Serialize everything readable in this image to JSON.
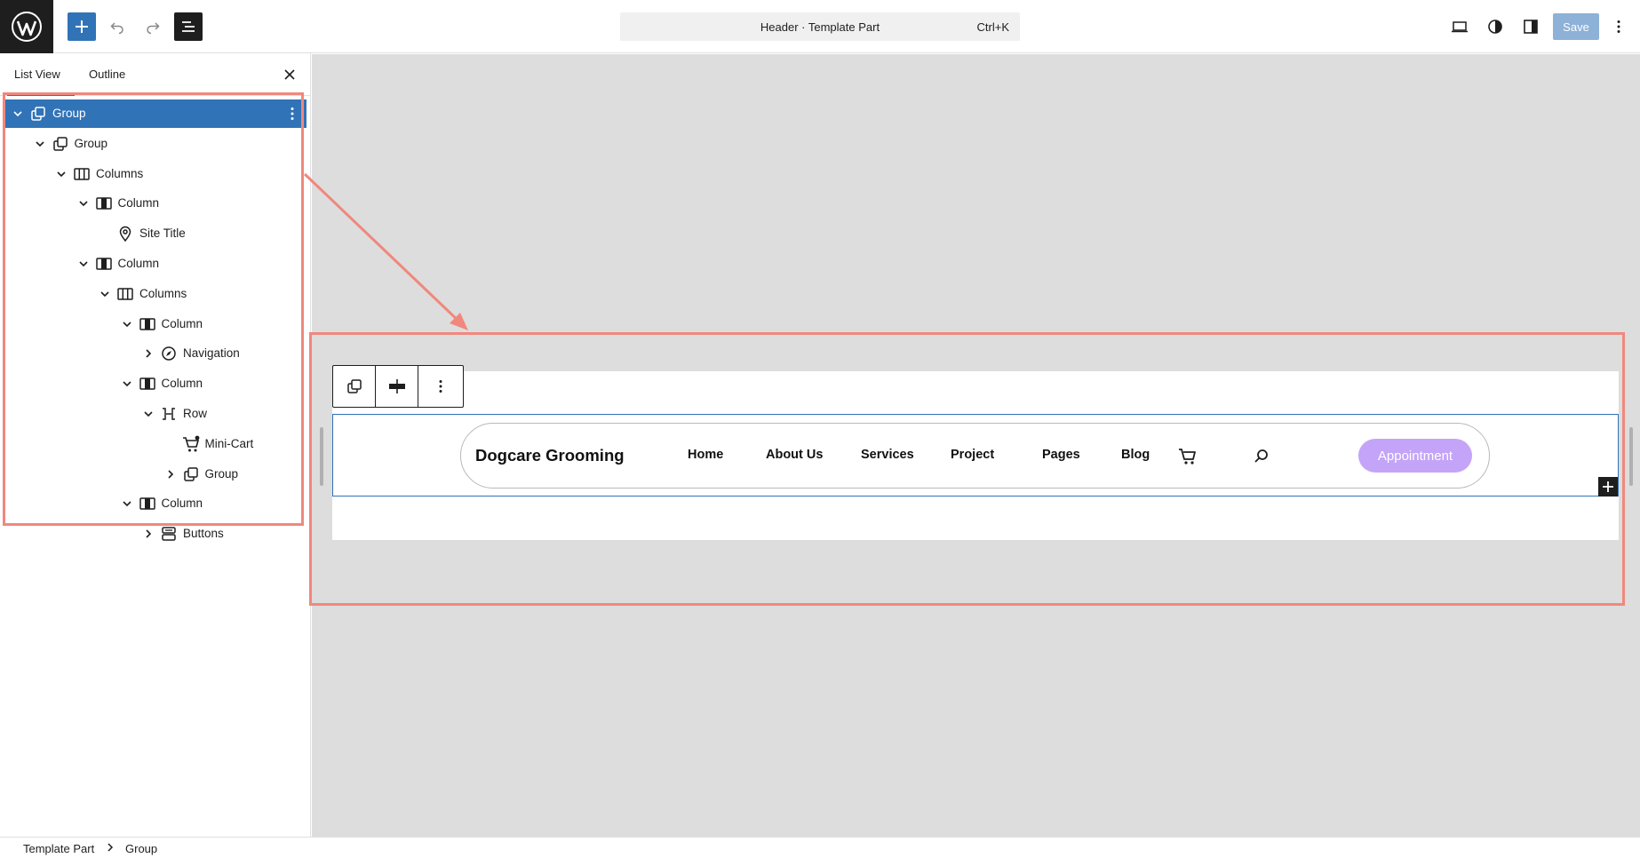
{
  "topbar": {
    "document_title": "Header · Template Part",
    "shortcut": "Ctrl+K",
    "save_label": "Save"
  },
  "sidebar": {
    "tabs": [
      "List View",
      "Outline"
    ],
    "active_tab": "List View",
    "tree": [
      {
        "label": "Group",
        "icon": "group-icon",
        "depth": 0,
        "expanded": true,
        "selected": true
      },
      {
        "label": "Group",
        "icon": "group-icon",
        "depth": 1,
        "expanded": true
      },
      {
        "label": "Columns",
        "icon": "columns-icon",
        "depth": 2,
        "expanded": true
      },
      {
        "label": "Column",
        "icon": "column-icon",
        "depth": 3,
        "expanded": true
      },
      {
        "label": "Site Title",
        "icon": "map-marker-icon",
        "depth": 4,
        "expanded": null
      },
      {
        "label": "Column",
        "icon": "column-icon",
        "depth": 3,
        "expanded": true
      },
      {
        "label": "Columns",
        "icon": "columns-icon",
        "depth": 4,
        "expanded": true
      },
      {
        "label": "Column",
        "icon": "column-icon",
        "depth": 5,
        "expanded": true
      },
      {
        "label": "Navigation",
        "icon": "compass-icon",
        "depth": 6,
        "expanded": false
      },
      {
        "label": "Column",
        "icon": "column-icon",
        "depth": 5,
        "expanded": true
      },
      {
        "label": "Row",
        "icon": "row-icon",
        "depth": 6,
        "expanded": true
      },
      {
        "label": "Mini-Cart",
        "icon": "cart-icon",
        "depth": 7,
        "expanded": null
      },
      {
        "label": "Group",
        "icon": "group-icon",
        "depth": 7,
        "expanded": false
      },
      {
        "label": "Column",
        "icon": "column-icon",
        "depth": 5,
        "expanded": true
      },
      {
        "label": "Buttons",
        "icon": "buttons-icon",
        "depth": 6,
        "expanded": false
      }
    ]
  },
  "breadcrumb": [
    "Template Part",
    "Group"
  ],
  "canvas": {
    "site_title": "Dogcare Grooming",
    "nav": [
      "Home",
      "About Us",
      "Services",
      "Project",
      "Pages",
      "Blog"
    ],
    "appointment_label": "Appointment"
  },
  "colors": {
    "accent": "#3173b7",
    "annotation": "#f0887d",
    "appointment_button": "#c4a4f8",
    "canvas_background": "#dddddd"
  }
}
